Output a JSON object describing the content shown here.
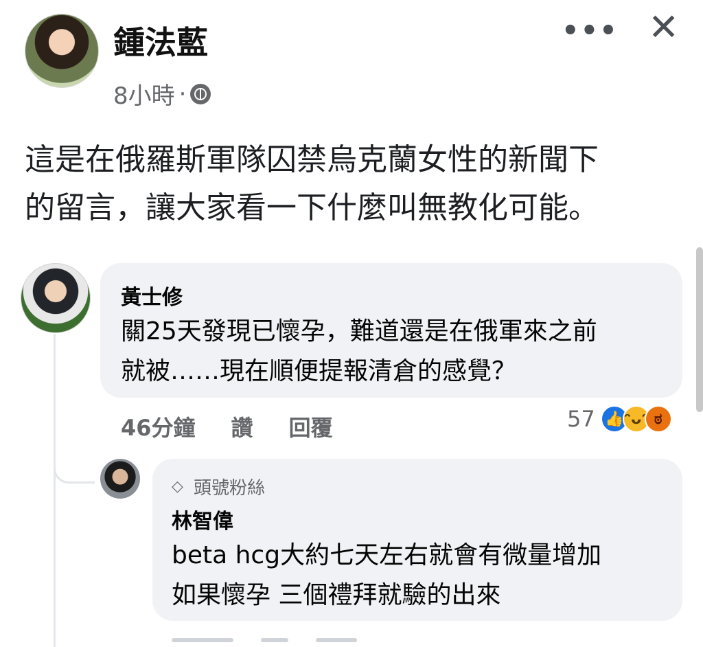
{
  "post": {
    "author": "鍾法藍",
    "time": "8小時",
    "separator": "·",
    "globe_icon": "globe-icon",
    "more_label": "•••",
    "close_label": "✕",
    "text": "這是在俄羅斯軍隊囚禁烏克蘭女性的新聞下\n的留言，讓大家看一下什麼叫無教化可能。"
  },
  "comments": [
    {
      "name": "黃士修",
      "text": "關25天發現已懷孕，難道還是在俄軍來之前\n就被……現在順便提報清倉的感覺？",
      "time": "46分鐘",
      "like_label": "讚",
      "reply_label": "回覆",
      "reaction_count": "57",
      "reactions": [
        "like-icon",
        "haha-icon",
        "angry-icon"
      ]
    },
    {
      "badge": "頭號粉絲",
      "badge_icon": "diamond-icon",
      "name": "林智偉",
      "text": "beta hcg大約七天左右就會有微量增加\n如果懷孕 三個禮拜就驗的出來"
    }
  ],
  "colors": {
    "background": "#ffffff",
    "bubble": "#f0f2f5",
    "secondary_text": "#65676b",
    "like": "#1b74e4",
    "haha": "#f7b928",
    "angry": "#e9710f"
  }
}
